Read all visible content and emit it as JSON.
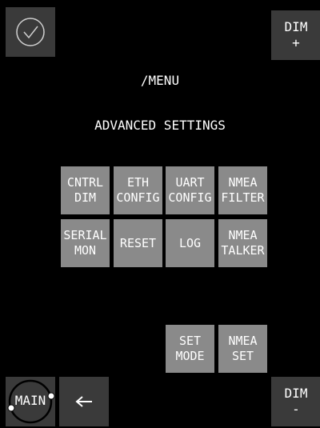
{
  "top_bar": {
    "ok_icon": "check-circle-icon",
    "dim_plus_label": "DIM\n+"
  },
  "header": {
    "path": "/MENU",
    "section": "ADVANCED SETTINGS"
  },
  "menu": {
    "row1": [
      "CNTRL\nDIM",
      "ETH\nCONFIG",
      "UART\nCONFIG",
      "NMEA\nFILTER"
    ],
    "row2": [
      "SERIAL\nMON",
      "RESET",
      "LOG",
      "NMEA\nTALKER"
    ],
    "row3": [
      "SET\nMODE",
      "NMEA\nSET"
    ]
  },
  "bottom_bar": {
    "main_label": "MAIN",
    "back_icon": "left-arrow-icon",
    "dim_minus_label": "DIM\n-"
  },
  "colors": {
    "background": "#000000",
    "button_dark": "#3a3a3a",
    "button_menu": "#8a8a8a",
    "text": "#ffffff"
  }
}
